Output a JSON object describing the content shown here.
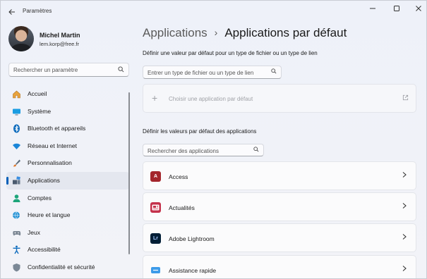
{
  "window": {
    "title": "Paramètres",
    "controls": {
      "minimize": "—",
      "maximize": "☐",
      "close": "✕"
    }
  },
  "profile": {
    "name": "Michel Martin",
    "email": "lem.korp@free.fr"
  },
  "sidebar": {
    "search_placeholder": "Rechercher un paramètre",
    "items": [
      {
        "label": "Accueil",
        "icon": "home-icon",
        "active": false
      },
      {
        "label": "Système",
        "icon": "display-icon",
        "active": false
      },
      {
        "label": "Bluetooth et appareils",
        "icon": "bluetooth-icon",
        "active": false
      },
      {
        "label": "Réseau et Internet",
        "icon": "wifi-icon",
        "active": false
      },
      {
        "label": "Personnalisation",
        "icon": "brush-icon",
        "active": false
      },
      {
        "label": "Applications",
        "icon": "apps-icon",
        "active": true
      },
      {
        "label": "Comptes",
        "icon": "person-icon",
        "active": false
      },
      {
        "label": "Heure et langue",
        "icon": "globe-clock-icon",
        "active": false
      },
      {
        "label": "Jeux",
        "icon": "gamepad-icon",
        "active": false
      },
      {
        "label": "Accessibilité",
        "icon": "accessibility-icon",
        "active": false
      },
      {
        "label": "Confidentialité et sécurité",
        "icon": "shield-icon",
        "active": false
      }
    ]
  },
  "main": {
    "breadcrumb": {
      "parent": "Applications",
      "separator": "›",
      "current": "Applications par défaut"
    },
    "file_type_section": {
      "label": "Définir une valeur par défaut pour un type de fichier ou un type de lien",
      "input_placeholder": "Entrer un type de fichier ou un type de lien"
    },
    "choose_app": {
      "plus": "+",
      "label": "Choisir une application par défaut",
      "external_icon": "external-link-icon"
    },
    "apps_section": {
      "label": "Définir les valeurs par défaut des applications",
      "search_placeholder": "Rechercher des applications"
    },
    "apps": [
      {
        "name": "Access",
        "icon_text": "A",
        "color": "#a4262c"
      },
      {
        "name": "Actualités",
        "icon_text": "N",
        "color": "#c4314b"
      },
      {
        "name": "Adobe Lightroom",
        "icon_text": "Lr",
        "color": "#001e36"
      },
      {
        "name": "Assistance rapide",
        "icon_text": "",
        "color": "#0f6cbd"
      }
    ]
  }
}
